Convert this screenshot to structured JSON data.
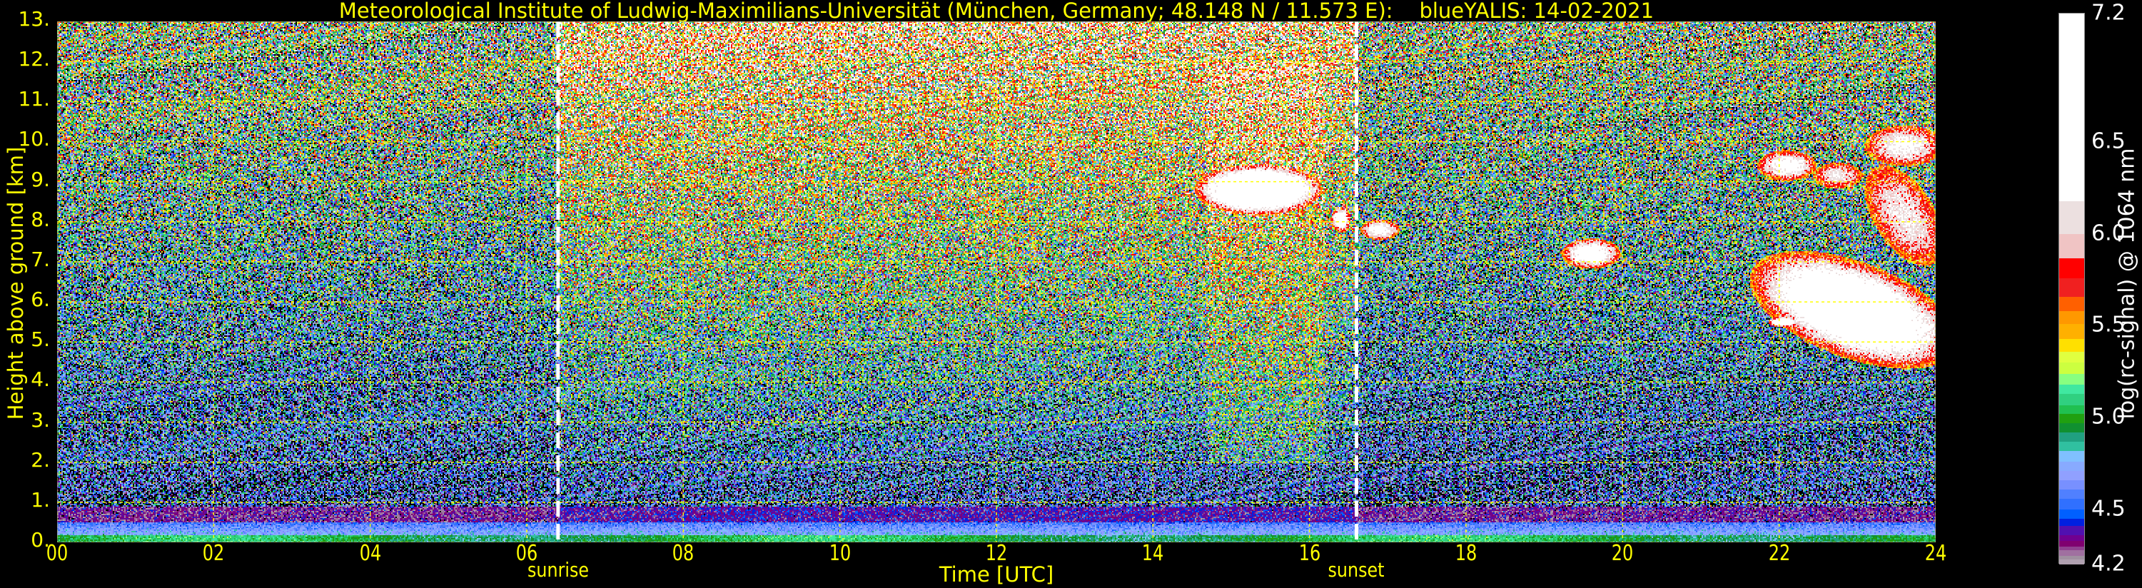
{
  "chart_data": {
    "type": "heatmap",
    "title": "Meteorological Institute of Ludwig-Maximilians-Universität (München, Germany; 48.148 N / 11.573 E):    blueYALIS: 14-02-2021",
    "xlabel": "Time [UTC]",
    "ylabel": "Height above ground [km]",
    "xlim": [
      0,
      24
    ],
    "ylim": [
      0,
      13
    ],
    "xticks": [
      "00",
      "02",
      "04",
      "06",
      "08",
      "10",
      "12",
      "14",
      "16",
      "18",
      "20",
      "22",
      "24"
    ],
    "yticks": [
      "0.",
      "1.",
      "2.",
      "3.",
      "4.",
      "5.",
      "6.",
      "7.",
      "8.",
      "9.",
      "10.",
      "11.",
      "12.",
      "13."
    ],
    "grid": true,
    "events": [
      {
        "label": "sunrise",
        "time": 6.4
      },
      {
        "label": "sunset",
        "time": 16.6
      }
    ],
    "colorbar": {
      "label": "log(rc-signal) @ 1064 nm",
      "range": [
        4.2,
        7.2
      ],
      "ticks": [
        "4.2",
        "4.5",
        "5.0",
        "5.5",
        "6.0",
        "6.5",
        "7.2"
      ],
      "tick_values": [
        4.2,
        4.5,
        5.0,
        5.5,
        6.0,
        6.5,
        7.2
      ],
      "boundaries": [
        4.2,
        4.23,
        4.25,
        4.28,
        4.3,
        4.33,
        4.36,
        4.41,
        4.45,
        4.5,
        4.56,
        4.61,
        4.66,
        4.71,
        4.76,
        4.82,
        4.87,
        4.92,
        4.97,
        5.02,
        5.07,
        5.13,
        5.18,
        5.24,
        5.3,
        5.36,
        5.43,
        5.51,
        5.58,
        5.66,
        5.76,
        5.87,
        6.0,
        6.18,
        7.2
      ],
      "colors": [
        "#b0a0b0",
        "#a090a0",
        "#a070a0",
        "#904090",
        "#800070",
        "#700090",
        "#5010b0",
        "#0020e0",
        "#0060ff",
        "#3070ff",
        "#5080ff",
        "#7890ff",
        "#90a0ff",
        "#88aaff",
        "#80c0ff",
        "#30c0a0",
        "#20a080",
        "#109030",
        "#20a010",
        "#20c050",
        "#30d080",
        "#40e8a0",
        "#88ff80",
        "#ccff40",
        "#e0ff40",
        "#ffe000",
        "#ffb000",
        "#ff9800",
        "#ff6000",
        "#f02020",
        "#ff0000",
        "#f0c4c4",
        "#ece0e0",
        "#ffffff"
      ]
    },
    "features": [
      {
        "name": "boundary-layer",
        "t_start": 0,
        "t_end": 24,
        "h_bottom": 0,
        "h_top": 0.5,
        "value": 4.9
      },
      {
        "name": "cloud",
        "t_start": 14.7,
        "t_end": 16.0,
        "h_bottom": 8.3,
        "h_top": 9.3,
        "value": 6.8
      },
      {
        "name": "cloud",
        "t_start": 16.3,
        "t_end": 16.5,
        "h_bottom": 7.8,
        "h_top": 8.3,
        "value": 6.3
      },
      {
        "name": "cloud",
        "t_start": 16.7,
        "t_end": 17.1,
        "h_bottom": 7.6,
        "h_top": 8.0,
        "value": 6.2
      },
      {
        "name": "cloud",
        "t_start": 19.3,
        "t_end": 19.9,
        "h_bottom": 6.9,
        "h_top": 7.5,
        "value": 6.3
      },
      {
        "name": "cloud",
        "t_start": 21.8,
        "t_end": 22.4,
        "h_bottom": 9.1,
        "h_top": 9.7,
        "value": 6.2
      },
      {
        "name": "cloud",
        "t_start": 22.5,
        "t_end": 23.0,
        "h_bottom": 8.9,
        "h_top": 9.4,
        "value": 6.0
      },
      {
        "name": "cloud",
        "t_start": 23.2,
        "t_end": 24.0,
        "h_bottom": 9.5,
        "h_top": 10.3,
        "value": 6.1
      },
      {
        "name": "cirrus",
        "t_start": 23.2,
        "t_end": 24.0,
        "h_bottom": 7.3,
        "h_top": 9.0,
        "value": 6.0
      },
      {
        "name": "cirrus",
        "t_start": 21.9,
        "t_end": 24.0,
        "h_bottom": 4.8,
        "h_top": 6.8,
        "value": 6.6
      },
      {
        "name": "cloud",
        "t_start": 21.9,
        "t_end": 22.2,
        "h_bottom": 5.4,
        "h_top": 5.6,
        "value": 6.6
      },
      {
        "name": "cloud",
        "t_start": 22.5,
        "t_end": 22.9,
        "h_bottom": 5.3,
        "h_top": 5.5,
        "value": 6.6
      }
    ]
  }
}
